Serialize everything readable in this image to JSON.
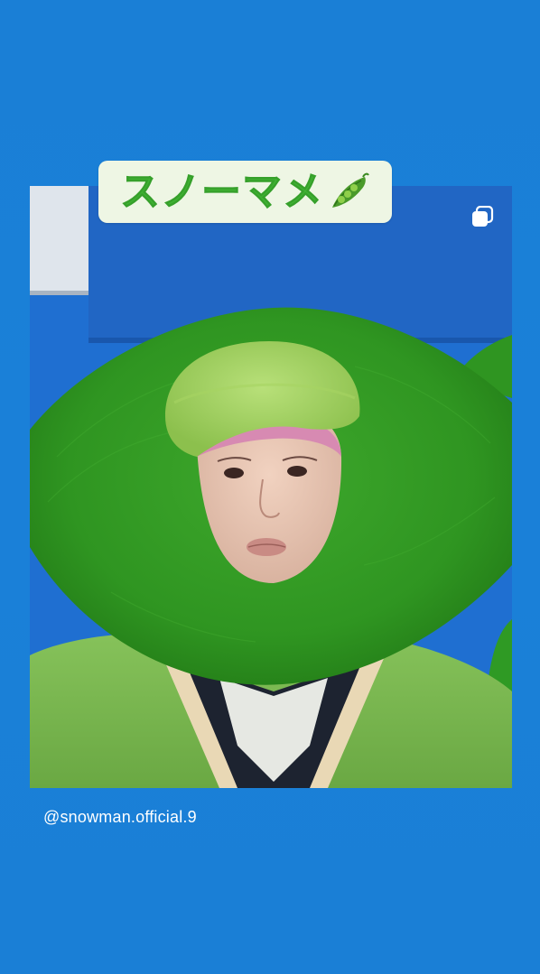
{
  "story": {
    "caption": {
      "text": "スノーマメ",
      "emoji": "peapod-icon",
      "text_color": "#3fb233",
      "background": "#eef6e4"
    },
    "shared_post": {
      "multi_image_indicator": "stacked-squares-icon"
    },
    "attribution": {
      "handle": "@snowman.official.9"
    },
    "colors": {
      "background": "#1a7fd6",
      "costume_green": "#3aa02a",
      "hat_green": "#9fd45a"
    }
  }
}
